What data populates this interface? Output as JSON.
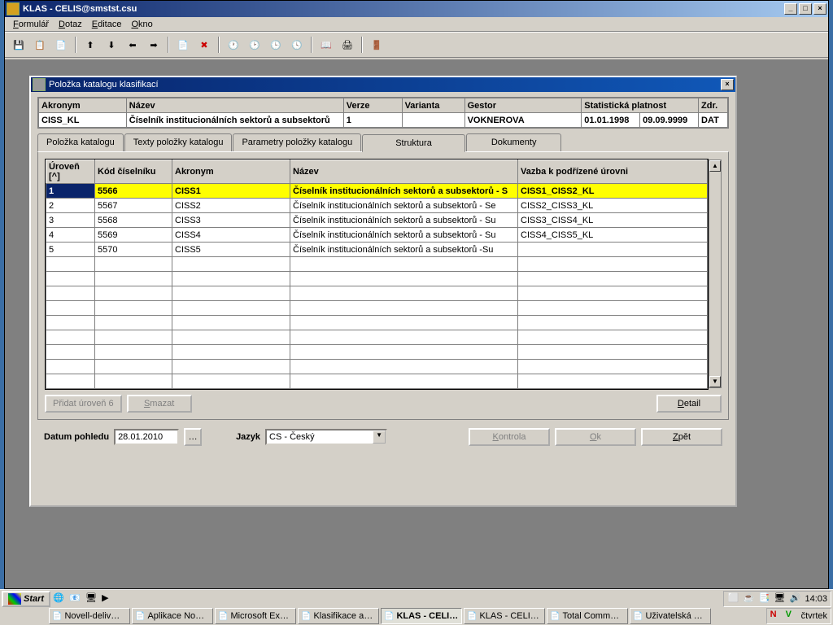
{
  "main_window": {
    "title": "KLAS - CELIS@smstst.csu"
  },
  "menubar": [
    "Formulář",
    "Dotaz",
    "Editace",
    "Okno"
  ],
  "dialog": {
    "title": "Položka katalogu klasifikací",
    "headers": {
      "akronym": "Akronym",
      "nazev": "Název",
      "verze": "Verze",
      "varianta": "Varianta",
      "gestor": "Gestor",
      "platnost": "Statistická platnost",
      "zdr": "Zdr."
    },
    "values": {
      "akronym": "CISS_KL",
      "nazev": "Číselník institucionálních sektorů a subsektorů",
      "verze": "1",
      "varianta": "",
      "gestor": "VOKNEROVA",
      "plat_od": "01.01.1998",
      "plat_do": "09.09.9999",
      "zdr": "DAT"
    },
    "tabs": [
      "Položka katalogu",
      "Texty položky katalogu",
      "Parametry položky katalogu",
      "Struktura",
      "Dokumenty"
    ],
    "table_headers": {
      "uroven": "Úroveň [^]",
      "kod": "Kód číselníku",
      "akronym": "Akronym",
      "nazev": "Název",
      "vazba": "Vazba k podřízené úrovni"
    },
    "rows": [
      {
        "uroven": "1",
        "kod": "5566",
        "akronym": "CISS1",
        "nazev": "Číselník institucionálních sektorů a subsektorů - S",
        "vazba": "CISS1_CISS2_KL"
      },
      {
        "uroven": "2",
        "kod": "5567",
        "akronym": "CISS2",
        "nazev": "Číselník institucionálních sektorů a subsektorů - Se",
        "vazba": "CISS2_CISS3_KL"
      },
      {
        "uroven": "3",
        "kod": "5568",
        "akronym": "CISS3",
        "nazev": "Číselník institucionálních sektorů a subsektorů - Su",
        "vazba": "CISS3_CISS4_KL"
      },
      {
        "uroven": "4",
        "kod": "5569",
        "akronym": "CISS4",
        "nazev": "Číselník institucionálních sektorů a subsektorů - Su",
        "vazba": "CISS4_CISS5_KL"
      },
      {
        "uroven": "5",
        "kod": "5570",
        "akronym": "CISS5",
        "nazev": "Číselník institucionálních sektorů a subsektorů -Su",
        "vazba": ""
      }
    ],
    "buttons": {
      "pridat": "Přidat úroveň 6",
      "smazat": "Smazat",
      "detail": "Detail"
    },
    "footer": {
      "datum_label": "Datum pohledu",
      "datum_value": "28.01.2010",
      "jazyk_label": "Jazyk",
      "jazyk_value": "CS - Český",
      "kontrola": "Kontrola",
      "ok": "Ok",
      "zpet": "Zpět"
    }
  },
  "taskbar": {
    "start": "Start",
    "tasks": [
      {
        "label": "Novell-deliv…",
        "active": false
      },
      {
        "label": "Aplikace No…",
        "active": false
      },
      {
        "label": "Microsoft Ex…",
        "active": false
      },
      {
        "label": "Klasifikace a…",
        "active": false
      },
      {
        "label": "KLAS - CELI…",
        "active": true
      },
      {
        "label": "KLAS - CELI…",
        "active": false
      },
      {
        "label": "Total Comm…",
        "active": false
      },
      {
        "label": "Uživatelská …",
        "active": false
      }
    ],
    "clock": "14:03",
    "day": "čtvrtek"
  }
}
